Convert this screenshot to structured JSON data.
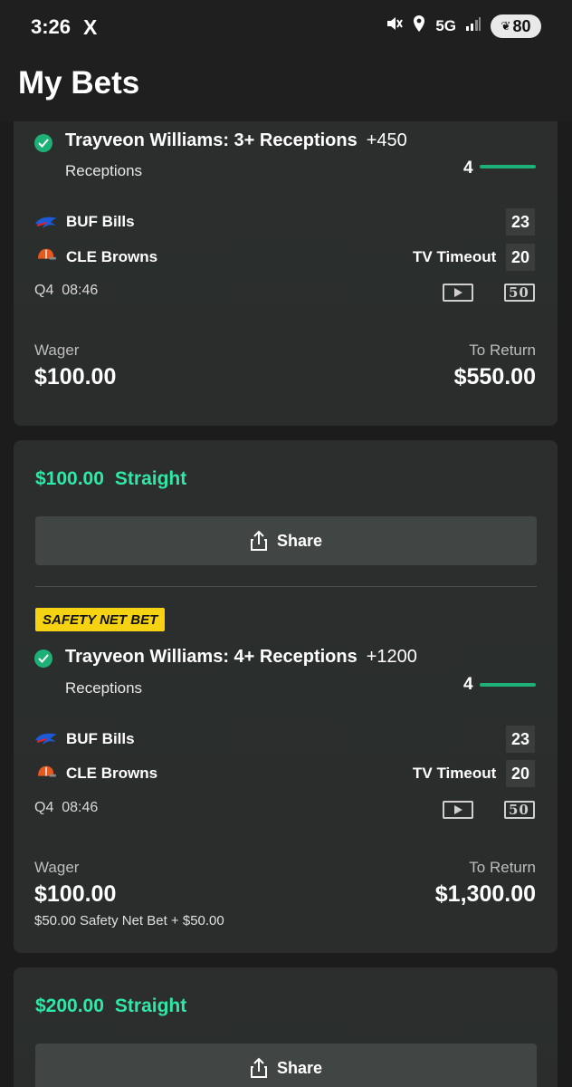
{
  "status_bar": {
    "time": "3:26",
    "x_icon": "X",
    "network": "5G",
    "battery": "80"
  },
  "header": {
    "title": "My Bets"
  },
  "bets": [
    {
      "selection": "Trayveon Williams: 3+ Receptions",
      "odds": "+450",
      "market": "Receptions",
      "progress": "4",
      "teams": [
        {
          "name": "BUF Bills",
          "score": "23"
        },
        {
          "name": "CLE Browns",
          "score": "20"
        }
      ],
      "game_status": "TV Timeout",
      "clock": "Q4  08:46",
      "wager_label": "Wager",
      "wager": "$100.00",
      "return_label": "To Return",
      "to_return": "$550.00"
    },
    {
      "summary_amount": "$100.00",
      "summary_type": "Straight",
      "share_label": "Share",
      "badge": "SAFETY NET BET",
      "selection": "Trayveon Williams: 4+ Receptions",
      "odds": "+1200",
      "market": "Receptions",
      "progress": "4",
      "teams": [
        {
          "name": "BUF Bills",
          "score": "23"
        },
        {
          "name": "CLE Browns",
          "score": "20"
        }
      ],
      "game_status": "TV Timeout",
      "clock": "Q4  08:46",
      "wager_label": "Wager",
      "wager": "$100.00",
      "wager_note": "$50.00 Safety Net Bet + $50.00",
      "return_label": "To Return",
      "to_return": "$1,300.00"
    },
    {
      "summary_amount": "$200.00",
      "summary_type": "Straight",
      "share_label": "Share"
    }
  ],
  "colors": {
    "accent": "#2ee8a7",
    "check": "#1db077",
    "badge": "#f6d312",
    "card": "#2b2e2c"
  }
}
